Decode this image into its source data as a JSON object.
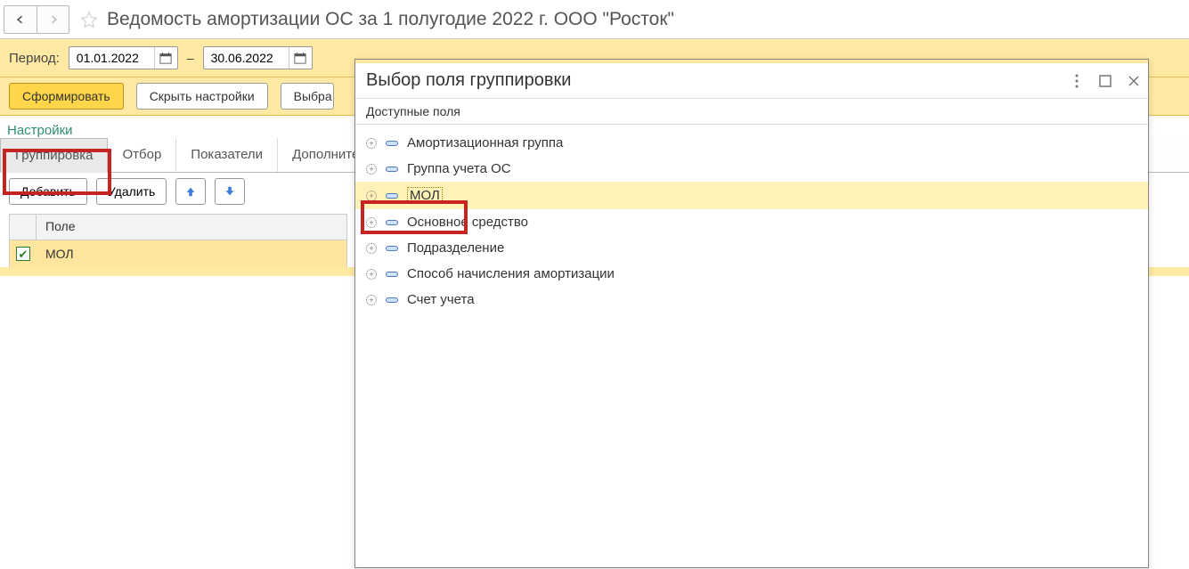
{
  "header": {
    "title": "Ведомость амортизации ОС за 1 полугодие 2022 г. ООО \"Росток\""
  },
  "period": {
    "label": "Период:",
    "from": "01.01.2022",
    "sep": "–",
    "to": "30.06.2022"
  },
  "toolbar": {
    "generate": "Сформировать",
    "hide_settings": "Скрыть настройки",
    "choose_settings": "Выбра"
  },
  "settings_heading": "Настройки",
  "tabs": {
    "grouping": "Группировка",
    "filter": "Отбор",
    "indicators": "Показатели",
    "extra": "Дополнител"
  },
  "grp_actions": {
    "add": "Добавить",
    "delete": "Удалить"
  },
  "grp_table": {
    "header": "Поле",
    "rows": [
      {
        "checked": true,
        "label": "МОЛ"
      }
    ]
  },
  "dialog": {
    "title": "Выбор поля группировки",
    "available_label": "Доступные поля",
    "fields": [
      "Амортизационная группа",
      "Группа учета ОС",
      "МОЛ",
      "Основное средство",
      "Подразделение",
      "Способ начисления амортизации",
      "Счет учета"
    ]
  }
}
